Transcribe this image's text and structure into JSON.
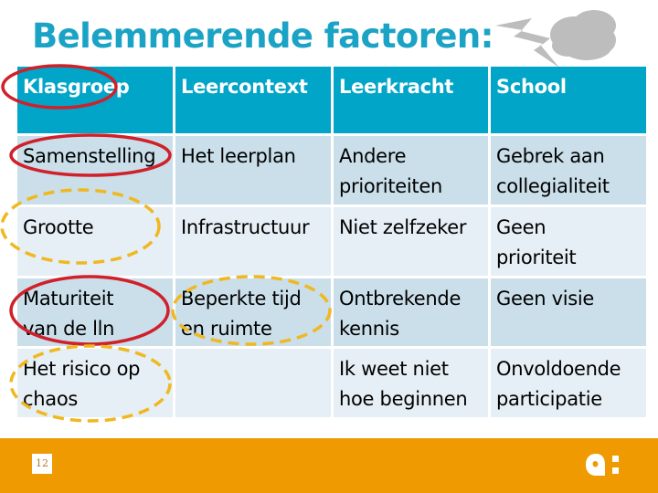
{
  "title": "Belemmerende factoren:",
  "table": {
    "headers": [
      "Klasgroep",
      "Leercontext",
      "Leerkracht",
      "School"
    ],
    "rows": [
      [
        "Samenstelling",
        "Het leerplan",
        "Andere\nprioriteiten",
        "Gebrek aan\ncollegialiteit"
      ],
      [
        "Grootte",
        "Infrastructuur",
        "Niet zelfzeker",
        "Geen\nprioriteit"
      ],
      [
        "Maturiteit\nvan de lln",
        "Beperkte tijd\nen ruimte",
        "Ontbrekende\nkennis",
        "Geen visie"
      ],
      [
        "Het risico op\nchaos",
        "",
        "Ik weet niet\nhoe beginnen",
        "Onvoldoende\nparticipatie"
      ]
    ]
  },
  "annotations": {
    "red_circled": [
      "Klasgroep",
      "Samenstelling",
      "Maturiteit van de lln"
    ],
    "yellow_dashed_circled": [
      "Grootte",
      "Beperkte tijd en ruimte",
      "Het risico op chaos"
    ]
  },
  "decoration": {
    "icons": [
      "lightning-icon",
      "cloud-icon"
    ]
  },
  "footer": {
    "page_number": "12",
    "logo": "a:"
  },
  "colors": {
    "title": "#1ba3c6",
    "header_bg": "#00a5c8",
    "row_dark": "#cadfea",
    "row_light": "#e6eff5",
    "footer_bg": "#ee9a00",
    "red_mark": "#d0202a",
    "yellow_mark": "#f0b820",
    "deco_gray": "#bdbdbd"
  }
}
